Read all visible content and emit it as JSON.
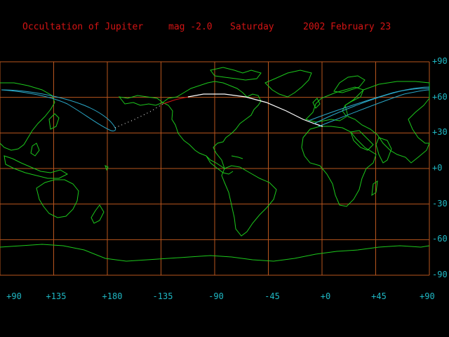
{
  "title": {
    "event": "Occultation of Jupiter",
    "magnitude": "mag -2.0",
    "weekday": "Saturday",
    "date": "2002 February 23"
  },
  "colors": {
    "title": "#d41414",
    "labels": "#1fb8c4",
    "grid": "#b8561e",
    "coast": "#1cc81c",
    "path_visible": "#ffffff",
    "path_red": "#d41414",
    "limit_lines": "#2aa8c8",
    "background": "#000000"
  },
  "latitude_labels": [
    "+90",
    "+60",
    "+30",
    "+0",
    "-30",
    "-60",
    "-90"
  ],
  "longitude_labels": [
    "+90",
    "+135",
    "+180",
    "-135",
    "-90",
    "-45",
    "+0",
    "+45",
    "+90"
  ]
}
